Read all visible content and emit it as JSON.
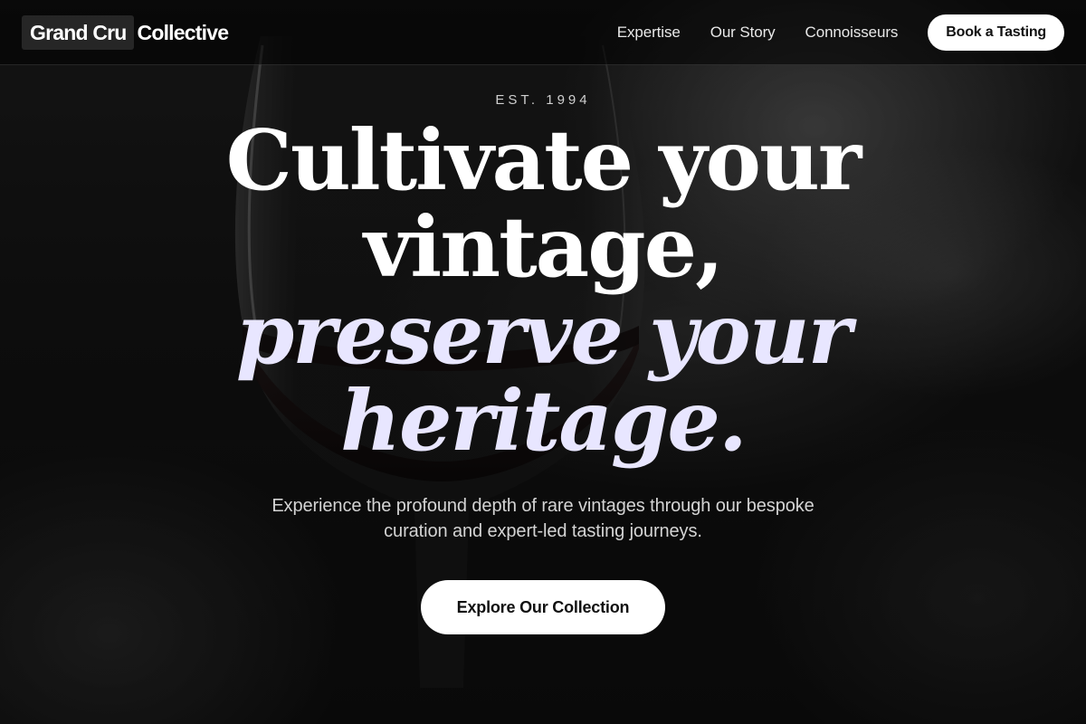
{
  "brand": {
    "boxed": "Grand Cru",
    "rest": "Collective"
  },
  "nav": {
    "links": [
      "Expertise",
      "Our Story",
      "Connoisseurs"
    ],
    "cta": "Book a Tasting"
  },
  "hero": {
    "eyebrow": "EST. 1994",
    "headline_line1": "Cultivate your",
    "headline_line2": "vintage,",
    "headline_line3": "preserve your",
    "headline_line4": "heritage.",
    "subtitle": "Experience the profound depth of rare vintages through our bespoke curation and expert-led tasting journeys.",
    "cta": "Explore Our Collection"
  },
  "colors": {
    "accent_italic": "#e8e6ff",
    "button_bg": "#ffffff",
    "button_text": "#111111"
  },
  "background": {
    "image_subject": "wine-glass-photo"
  }
}
